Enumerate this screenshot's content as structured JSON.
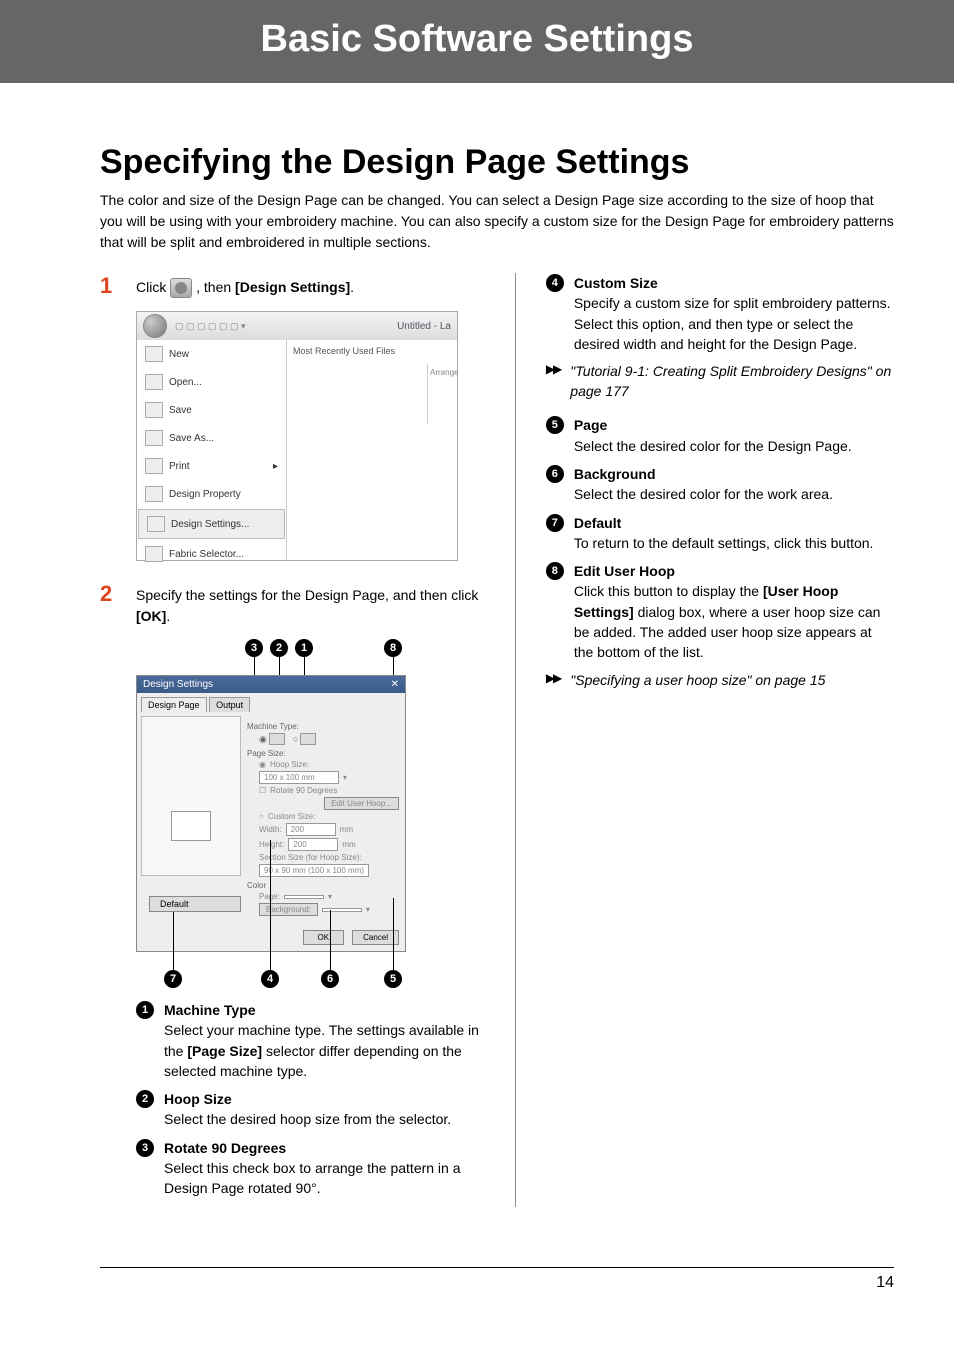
{
  "header": {
    "title": "Basic Software Settings"
  },
  "main": {
    "title": "Specifying the Design Page Settings",
    "intro": "The color and size of the Design Page can be changed. You can select a Design Page size according to the size of hoop that you will be using with your embroidery machine. You can also specify a custom size for the Design Page for embroidery patterns that will be split and embroidered in multiple sections."
  },
  "steps": {
    "s1": {
      "num": "1",
      "pre": "Click ",
      "post": ", then ",
      "bold": "[Design Settings]",
      "end": "."
    },
    "s2": {
      "num": "2",
      "line1": "Specify the settings for the Design Page, and then click ",
      "bold": "[OK]",
      "end": "."
    }
  },
  "screenshot1": {
    "title": "Untitled - La",
    "mru": "Most Recently Used Files",
    "right_label": "Arrange",
    "menu": [
      "New",
      "Open...",
      "Save",
      "Save As...",
      "Print",
      "Design Property",
      "Design Settings...",
      "Fabric Selector..."
    ]
  },
  "screenshot2": {
    "title": "Design Settings",
    "tab1": "Design Page",
    "tab2": "Output",
    "machine_type": "Machine Type:",
    "page_size": "Page Size:",
    "hoop_size": "Hoop Size:",
    "hoop_value": "100 x 100 mm",
    "rotate": "Rotate 90 Degrees",
    "edit_hoop": "Edit User Hoop...",
    "custom_size": "Custom Size:",
    "width": "Width:",
    "height": "Height:",
    "w_val": "200",
    "h_val": "200",
    "mm": "mm",
    "section": "Section Size (for Hoop Size):",
    "section_val": "90 x  90 mm (100 x 100 mm)",
    "color": "Color",
    "page": "Page:",
    "background": "Background:",
    "default": "Default",
    "ok": "OK",
    "cancel": "Cancel"
  },
  "callouts": {
    "c1": "1",
    "c2": "2",
    "c3": "3",
    "c4": "4",
    "c5": "5",
    "c6": "6",
    "c7": "7",
    "c8": "8"
  },
  "items_left": [
    {
      "num": "1",
      "title": "Machine Type",
      "body_pre": "Select your machine type. The settings available in the ",
      "body_bold": "[Page Size]",
      "body_post": " selector differ depending on the selected machine type."
    },
    {
      "num": "2",
      "title": "Hoop Size",
      "body": "Select the desired hoop size from the selector."
    },
    {
      "num": "3",
      "title": "Rotate 90 Degrees",
      "body": "Select this check box to arrange the pattern in a Design Page rotated 90°."
    }
  ],
  "items_right": [
    {
      "num": "4",
      "title": "Custom Size",
      "body": "Specify a custom size for split embroidery patterns.\nSelect this option, and then type or select the desired width and height for the Design Page."
    },
    {
      "num": "5",
      "title": "Page",
      "body": "Select the desired color for the Design Page."
    },
    {
      "num": "6",
      "title": "Background",
      "body": "Select the desired color for the work area."
    },
    {
      "num": "7",
      "title": "Default",
      "body": "To return to the default settings, click this button."
    },
    {
      "num": "8",
      "title": "Edit User Hoop",
      "body_pre": "Click this button to display the ",
      "body_bold": "[User Hoop Settings]",
      "body_post": " dialog box, where a user hoop size can be added. The added user hoop size appears at the bottom of the list."
    }
  ],
  "xrefs": {
    "x1": "\"Tutorial 9-1: Creating Split Embroidery Designs\" on page 177",
    "x2": "\"Specifying a user hoop size\" on page 15"
  },
  "page_number": "14"
}
